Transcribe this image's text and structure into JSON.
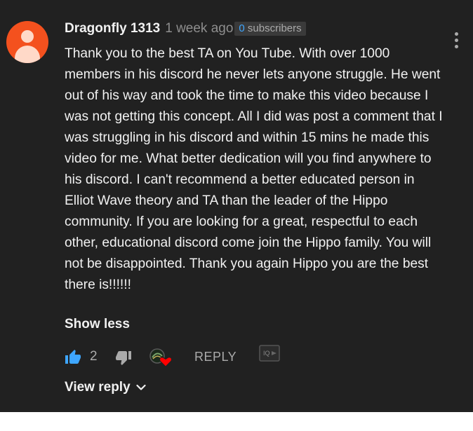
{
  "comment": {
    "author": "Dragonfly 1313",
    "time": "1 week ago",
    "subscriber_count": "0",
    "subscriber_label": " subscribers",
    "text": "Thank you to the best TA on You Tube. With over 1000 members in his discord he never lets anyone struggle. He went out of his way and took the time to make this video because I was not getting this concept. All I did was post a comment that I was struggling in his discord and within 15 mins he made this video for me. What better dedication will you find anywhere to his discord. I can't recommend a better educated person in Elliot Wave theory and TA than the leader of the Hippo community. If you are looking for a great, respectful to each other, educational discord come join the Hippo family. You will not be disappointed. Thank you again Hippo you are the best there is!!!!!!",
    "show_less_label": "Show less",
    "like_count": "2",
    "reply_label": "REPLY",
    "view_reply_label": "View reply"
  },
  "icons": {
    "like": "thumbs-up-icon",
    "dislike": "thumbs-down-icon",
    "creator_heart": "creator-heart-icon",
    "more": "kebab-menu-icon",
    "extension": "iq-extension-icon",
    "chevron": "chevron-down-icon"
  },
  "colors": {
    "background": "#212121",
    "text": "#f1f1f1",
    "muted": "#aaaaaa",
    "accent": "#3ea6ff",
    "avatar": "#f4511e",
    "heart": "#ff0000"
  }
}
